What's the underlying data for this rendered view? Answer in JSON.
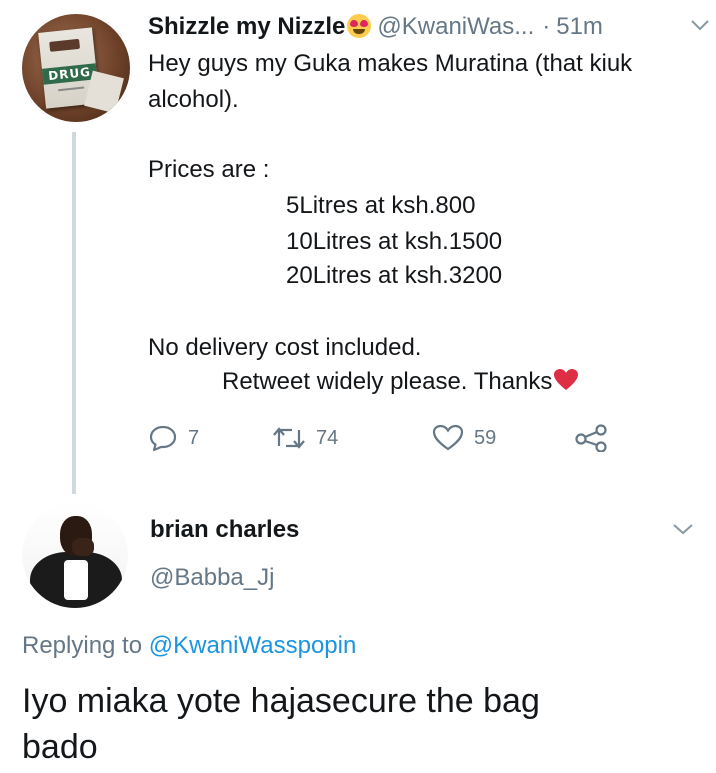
{
  "tweet": {
    "author_name": "Shizzle my Nizzle",
    "name_emoji": "smiling-face-with-heart-eyes",
    "handle": "@KwaniWas...",
    "separator": "·",
    "time": "51m",
    "avatar_label": "DRUG",
    "text_lines": [
      "Hey guys my Guka makes Muratina (that kiuk",
      "alcohol).",
      "Prices are :",
      "5Litres at ksh.800",
      "10Litres at ksh.1500",
      "20Litres at ksh.3200",
      "No delivery cost included.",
      "Retweet widely please. Thanks"
    ],
    "trailing_emoji": "red-heart",
    "stats": {
      "replies": "7",
      "retweets": "74",
      "likes": "59"
    }
  },
  "reply": {
    "author_name": "brian charles",
    "handle": "@Babba_Jj",
    "replying_prefix": "Replying to",
    "replying_to": "@KwaniWasspopin",
    "text_lines": [
      "Iyo miaka yote hajasecure the bag",
      "bado"
    ]
  },
  "colors": {
    "text": "#14171a",
    "secondary": "#657786",
    "link": "#1b95e0",
    "thread_line": "#cfd9de",
    "heart": "#e0245e"
  }
}
